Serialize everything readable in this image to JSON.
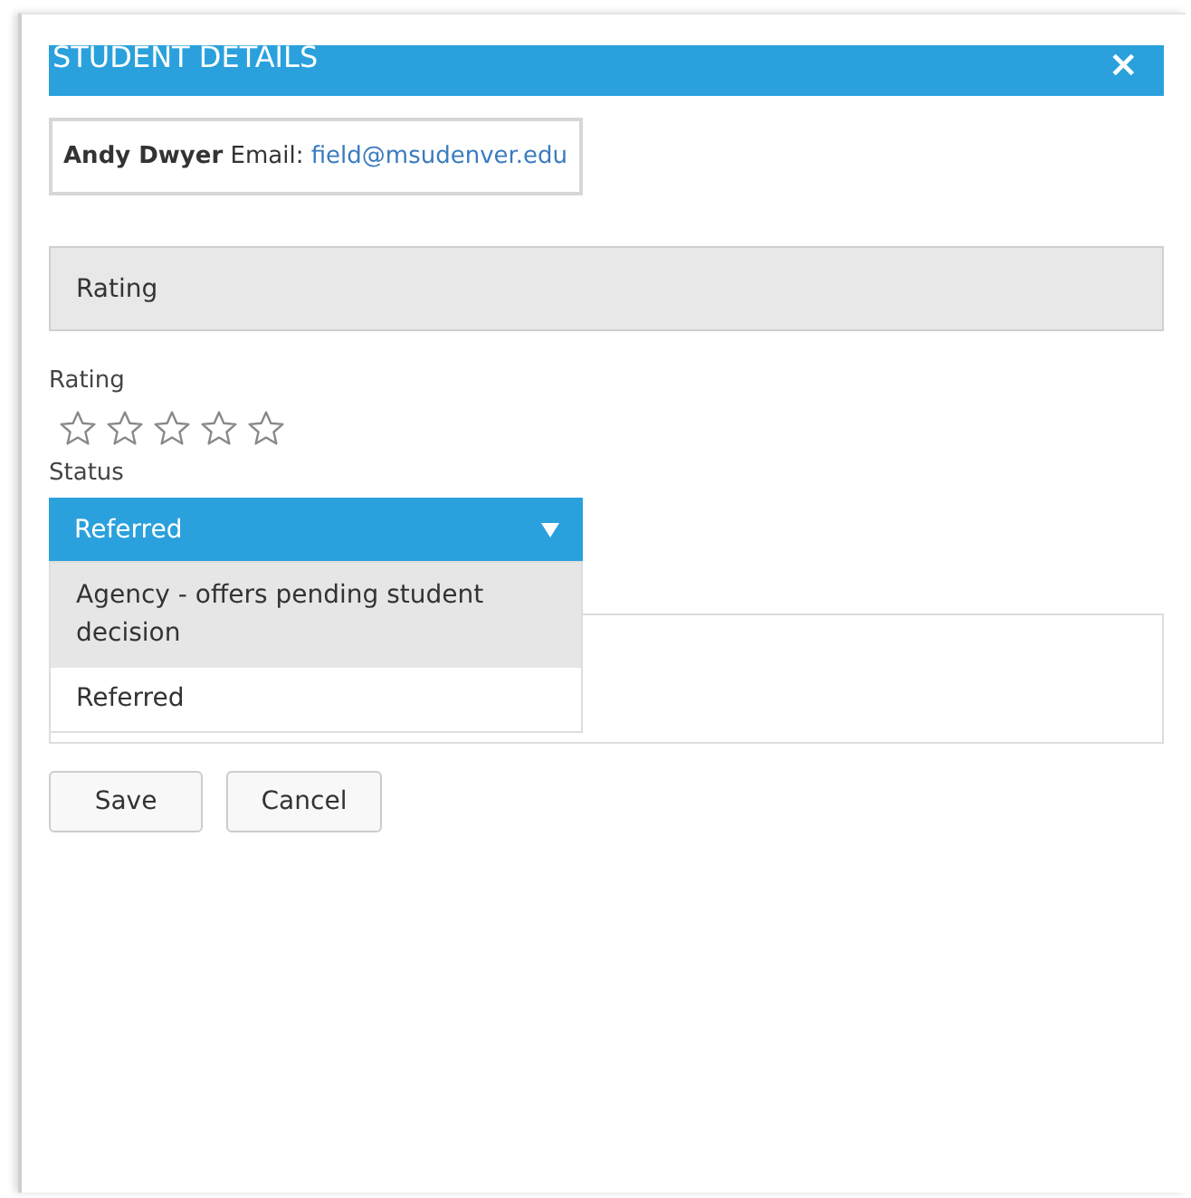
{
  "dialog": {
    "title": "STUDENT DETAILS",
    "close": "×"
  },
  "student": {
    "name": "Andy Dwyer",
    "email_label": "Email:",
    "email": "field@msudenver.edu"
  },
  "section": {
    "title": "Rating"
  },
  "rating": {
    "label": "Rating",
    "stars": 0
  },
  "status": {
    "label": "Status",
    "value": "Referred",
    "expanded": true,
    "options": [
      {
        "label": "Agency - offers pending student decision",
        "hovered": true
      },
      {
        "label": "Referred",
        "hovered": false
      }
    ]
  },
  "buttons": [
    {
      "label": "Save"
    },
    {
      "label": "Cancel"
    }
  ]
}
